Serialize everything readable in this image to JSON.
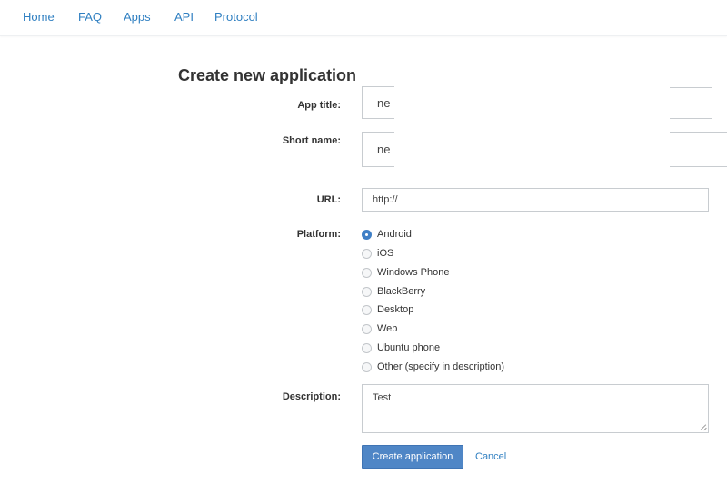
{
  "nav": [
    "Home",
    "FAQ",
    "Apps",
    "API",
    "Protocol"
  ],
  "form": {
    "title": "Create new application",
    "app_title": {
      "label": "App title:",
      "value": "ne"
    },
    "short_name": {
      "label": "Short name:",
      "value": "ne"
    },
    "url": {
      "label": "URL:",
      "value": "http://"
    },
    "platform": {
      "label": "Platform:",
      "selected": "Android",
      "options": [
        "Android",
        "iOS",
        "Windows Phone",
        "BlackBerry",
        "Desktop",
        "Web",
        "Ubuntu phone",
        "Other (specify in description)"
      ]
    },
    "description": {
      "label": "Description:",
      "value": "Test"
    },
    "submit_label": "Create application",
    "cancel_label": "Cancel"
  },
  "colors": {
    "link": "#2f7fc1",
    "primary": "#4f86c6"
  }
}
